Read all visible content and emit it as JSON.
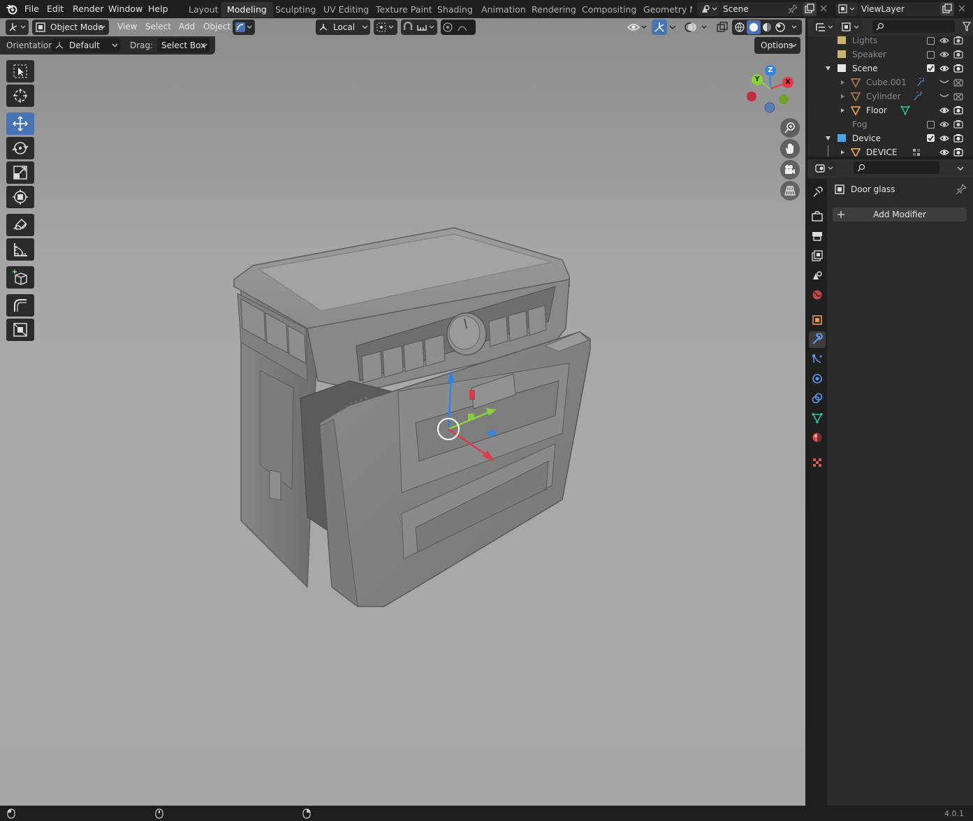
{
  "menubar": {
    "items": [
      "File",
      "Edit",
      "Render",
      "Window",
      "Help"
    ]
  },
  "workspaces": {
    "tabs": [
      "Layout",
      "Modeling",
      "Sculpting",
      "UV Editing",
      "Texture Paint",
      "Shading",
      "Animation",
      "Rendering",
      "Compositing",
      "Geometry Nc"
    ],
    "active": "Modeling"
  },
  "scene": {
    "name": "Scene"
  },
  "viewlayer": {
    "name": "ViewLayer"
  },
  "viewport_header": {
    "mode": "Object Mode",
    "menus": [
      "View",
      "Select",
      "Add",
      "Object"
    ],
    "transform_orientation": "Local"
  },
  "tool_settings": {
    "orientation_label": "Orientation:",
    "orientation_value": "Default",
    "drag_label": "Drag:",
    "drag_value": "Select Box",
    "options_label": "Options"
  },
  "toolbar": {
    "tools": [
      "select-box",
      "cursor",
      "move",
      "rotate",
      "scale",
      "transform",
      "annotate",
      "measure",
      "add-cube",
      "bevel",
      "inset"
    ],
    "active_tool": "move"
  },
  "gizmo": {
    "x_label": "X",
    "y_label": "Y",
    "z_label": "Z",
    "colors": {
      "x": "#e2394b",
      "y": "#8bd13c",
      "z": "#2f84e8"
    }
  },
  "outliner": {
    "rows": [
      {
        "label": "Lights",
        "type": "collection",
        "dim": true
      },
      {
        "label": "Speaker",
        "type": "collection",
        "dim": true
      },
      {
        "label": "Scene",
        "type": "collection",
        "dim": false
      },
      {
        "label": "Cube.001",
        "type": "mesh",
        "dim": true
      },
      {
        "label": "Cylinder",
        "type": "mesh",
        "dim": true
      },
      {
        "label": "Floor",
        "type": "mesh",
        "dim": false
      },
      {
        "label": "Fog",
        "type": "object",
        "dim": true
      },
      {
        "label": "Device",
        "type": "collection",
        "dim": false
      },
      {
        "label": "DEVICE",
        "type": "mesh",
        "dim": false
      }
    ]
  },
  "properties": {
    "object_name": "Door glass",
    "add_modifier_label": "Add Modifier",
    "active_tab": "modifiers"
  },
  "statusbar": {
    "version": "4.0.1"
  },
  "colors": {
    "accent": "#4772b3",
    "collection": "#c8b46e",
    "mesh": "#e89a4f"
  }
}
